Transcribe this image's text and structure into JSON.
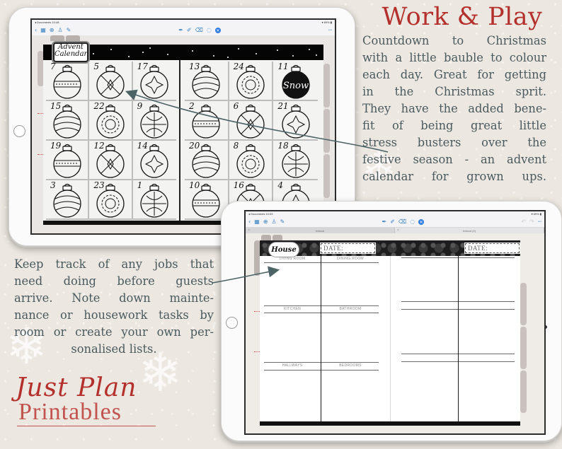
{
  "headline": "Work & Play",
  "advent_description": [
    "Countdown to Christmas",
    "with a little bauble to colour",
    "each day.  Great for getting",
    "in the Christmas sprit.",
    "They have the added bene-",
    "fit of being great little",
    "stress busters over the",
    "festive season - an advent",
    "calendar for grown ups."
  ],
  "house_description": [
    "Keep track of any jobs that",
    "need doing before guests",
    "arrive.  Note down mainte-",
    "nance or housework tasks by",
    "room or create your own per-",
    "sonalised lists."
  ],
  "brand": {
    "script": "Just Plan",
    "print": "Printables",
    "color": "#b4302c"
  },
  "ipad_advent": {
    "status_left": "◂ Documents  10:48",
    "status_right": "▾ 89% ▮",
    "toolbar_left_icons": [
      "back-chevron-icon",
      "grid-icon",
      "add-icon",
      "share-icon",
      "edit-icon"
    ],
    "toolbar_left_glyphs": [
      "‹",
      "▦",
      "⊕",
      "♙",
      "✎"
    ],
    "toolbar_mid_glyphs": [
      "✒",
      "✐",
      "⌫",
      "◌"
    ],
    "toolbar_close_glyph": "✕",
    "toolbar_more": "•••",
    "badge_title_line1": "Advent",
    "badge_title_line2": "Calendar",
    "left_page_days": [
      "7",
      "5",
      "17",
      "15",
      "22",
      "9",
      "19",
      "12",
      "14",
      "3",
      "23",
      "1"
    ],
    "right_page_days": [
      "13",
      "24",
      "11",
      "2",
      "6",
      "21",
      "20",
      "8",
      "18",
      "10",
      "16",
      "4"
    ],
    "snow_bauble_text": "Snow"
  },
  "ipad_house": {
    "status_left": "◂ Documents  10:53",
    "status_right": "▾ 89% ▮",
    "toolbar_left_glyphs": [
      "‹",
      "▦",
      "⊕",
      "♙",
      "✎"
    ],
    "toolbar_mid_glyphs": [
      "✒",
      "✐",
      "⌫",
      "◌"
    ],
    "toolbar_close_glyph": "✕",
    "toolbar_right_glyphs": [
      "↶",
      "↷"
    ],
    "toolbar_more": "•••",
    "tabs": [
      {
        "label": "Ireland",
        "close": "×"
      },
      {
        "label": "Ireland (2)",
        "close": "×"
      }
    ],
    "title": "House",
    "date_label_left": "DATE:",
    "date_label_right": "DATE:",
    "rooms": [
      {
        "label": "LIVING ROOM"
      },
      {
        "label": "DINING ROOM"
      },
      {
        "label": "KITCHEN"
      },
      {
        "label": "BATHROOM"
      },
      {
        "label": "HALLWAYS"
      },
      {
        "label": "BEDROOMS"
      }
    ]
  },
  "colors": {
    "accent_red": "#b4302c",
    "body_text": "#4a5a5e",
    "ios_blue": "#2e7de0",
    "background": "#ece7e0"
  }
}
